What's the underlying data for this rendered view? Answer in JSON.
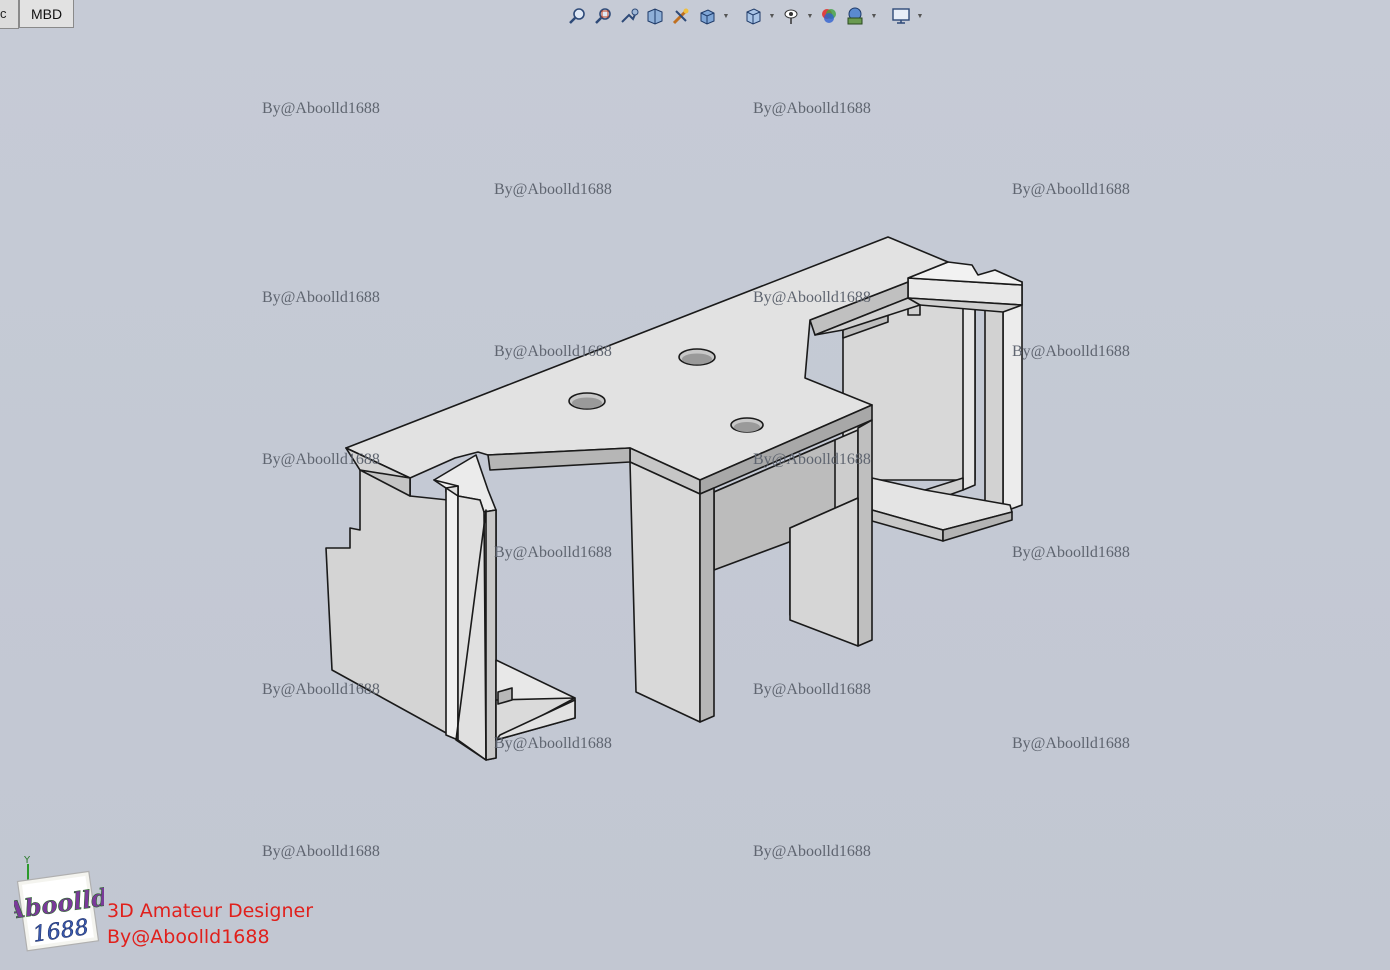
{
  "tabs": {
    "left_partial": "c",
    "mbd": "MBD"
  },
  "toolbar": {
    "icons": [
      "zoom-to-fit-icon",
      "zoom-to-area-icon",
      "previous-view-icon",
      "section-view-icon",
      "dynamic-annotation-icon",
      "view-orientation-icon",
      "display-style-icon",
      "hide-show-items-icon",
      "edit-appearance-icon",
      "apply-scene-icon",
      "view-settings-icon"
    ]
  },
  "watermark_text": "By@Aboolld1688",
  "logo": {
    "line1": "Aboolld",
    "line2": "1688"
  },
  "triad": {
    "y_label": "Y"
  },
  "caption": {
    "line1": "3D Amateur Designer",
    "line2": "By@Aboolld1688"
  },
  "colors": {
    "background": "#c4c9d4",
    "caption": "#e0201c",
    "watermark": "#5f6570"
  }
}
